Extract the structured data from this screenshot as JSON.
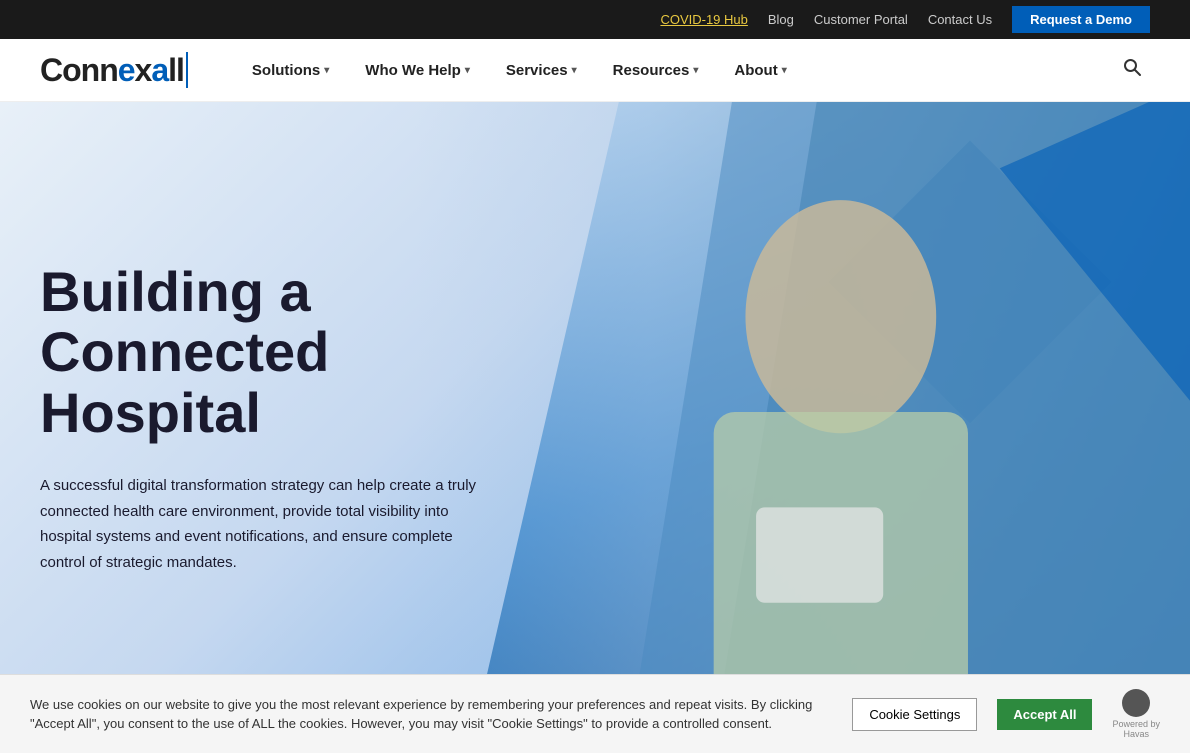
{
  "topbar": {
    "covid_link": "COVID-19 Hub",
    "blog": "Blog",
    "customer_portal": "Customer Portal",
    "contact_us": "Contact Us",
    "request_demo": "Request a Demo"
  },
  "nav": {
    "logo_text": "Connexall",
    "items": [
      {
        "label": "Solutions",
        "has_dropdown": true
      },
      {
        "label": "Who We Help",
        "has_dropdown": true
      },
      {
        "label": "Services",
        "has_dropdown": true
      },
      {
        "label": "Resources",
        "has_dropdown": true
      },
      {
        "label": "About",
        "has_dropdown": true
      }
    ],
    "search_label": "Search"
  },
  "hero": {
    "title_line1": "Building a",
    "title_line2": "Connected",
    "title_line3": "Hospital",
    "subtitle": "A successful digital transformation strategy can help create a truly connected health care environment, provide total visibility into hospital systems and event notifications, and ensure complete control of strategic mandates."
  },
  "cookie_banner": {
    "text": "We use cookies on our website to give you the most relevant experience by remembering your preferences and repeat visits. By clicking \"Accept All\", you consent to the use of ALL the cookies. However, you may visit \"Cookie Settings\" to provide a controlled consent.",
    "settings_btn": "Cookie Settings",
    "accept_btn": "Accept All",
    "powered_by": "Powered by",
    "havas_label": "Havas"
  }
}
